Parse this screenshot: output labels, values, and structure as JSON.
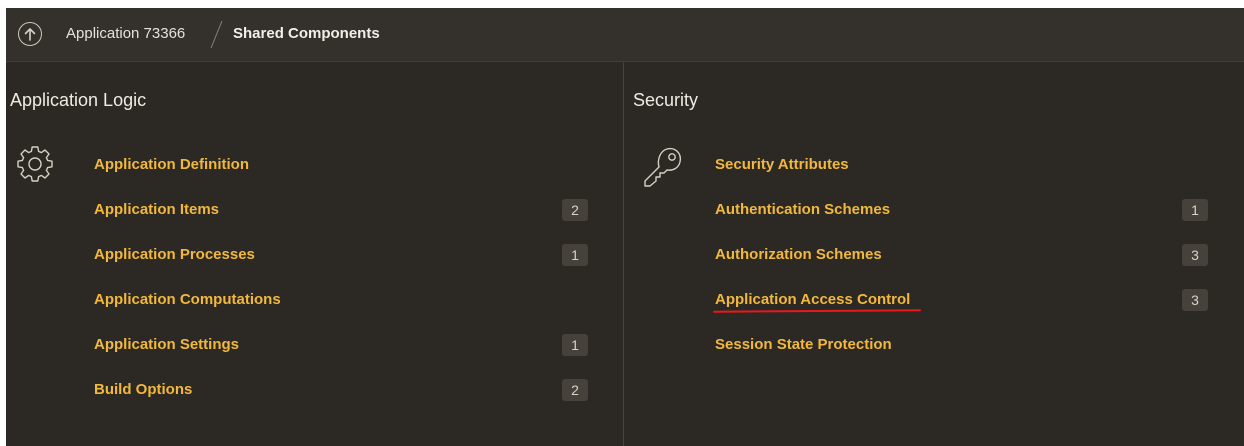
{
  "breadcrumb": {
    "app": "Application 73366",
    "current": "Shared Components"
  },
  "icons": {
    "up": "arrow-up-circle-icon",
    "logic": "gear-icon",
    "security": "key-icon"
  },
  "colors": {
    "link": "#f2b83d",
    "background": "#2c2925",
    "annotation": "#e8181b"
  },
  "application_logic": {
    "title": "Application Logic",
    "items": [
      {
        "label": "Application Definition",
        "count": ""
      },
      {
        "label": "Application Items",
        "count": "2"
      },
      {
        "label": "Application Processes",
        "count": "1"
      },
      {
        "label": "Application Computations",
        "count": ""
      },
      {
        "label": "Application Settings",
        "count": "1"
      },
      {
        "label": "Build Options",
        "count": "2"
      }
    ]
  },
  "security": {
    "title": "Security",
    "items": [
      {
        "label": "Security Attributes",
        "count": ""
      },
      {
        "label": "Authentication Schemes",
        "count": "1"
      },
      {
        "label": "Authorization Schemes",
        "count": "3"
      },
      {
        "label": "Application Access Control",
        "count": "3"
      },
      {
        "label": "Session State Protection",
        "count": ""
      }
    ]
  }
}
